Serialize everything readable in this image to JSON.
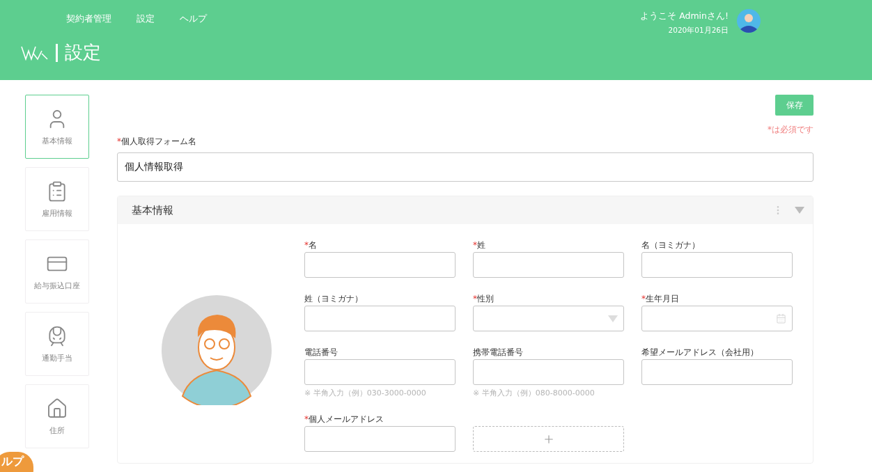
{
  "top_nav": [
    {
      "label": "契約者管理"
    },
    {
      "label": "設定"
    },
    {
      "label": "ヘルプ"
    }
  ],
  "page_title": "設定",
  "user": {
    "greeting": "ようこそ Adminさん!",
    "date": "2020年01月26日"
  },
  "sidebar": {
    "items": [
      {
        "label": "基本情報",
        "selected": true
      },
      {
        "label": "雇用情報",
        "selected": false
      },
      {
        "label": "給与振込口座",
        "selected": false
      },
      {
        "label": "通勤手当",
        "selected": false
      },
      {
        "label": "住所",
        "selected": false
      }
    ]
  },
  "required_mark": "*",
  "save_button": "保存",
  "required_note": "*は必須です",
  "form_name": {
    "label": "個人取得フォーム名",
    "required": true,
    "value": "個人情報取得"
  },
  "section": {
    "title": "基本情報",
    "expanded": true,
    "fields": [
      {
        "label": "名",
        "required": true,
        "kind": "text"
      },
      {
        "label": "姓",
        "required": true,
        "kind": "text"
      },
      {
        "label": "名（ヨミガナ）",
        "required": false,
        "kind": "text"
      },
      {
        "label": "姓（ヨミガナ）",
        "required": false,
        "kind": "text"
      },
      {
        "label": "性別",
        "required": true,
        "kind": "select"
      },
      {
        "label": "生年月日",
        "required": true,
        "kind": "date"
      },
      {
        "label": "電話番号",
        "required": false,
        "kind": "text",
        "hint": "※ 半角入力（例）030-3000-0000"
      },
      {
        "label": "携帯電話番号",
        "required": false,
        "kind": "text",
        "hint": "※ 半角入力（例）080-8000-0000"
      },
      {
        "label": "希望メールアドレス（会社用）",
        "required": false,
        "kind": "text"
      },
      {
        "label": "個人メールアドレス",
        "required": true,
        "kind": "text"
      },
      {
        "kind": "add"
      }
    ]
  },
  "help_tab": "ルプ"
}
